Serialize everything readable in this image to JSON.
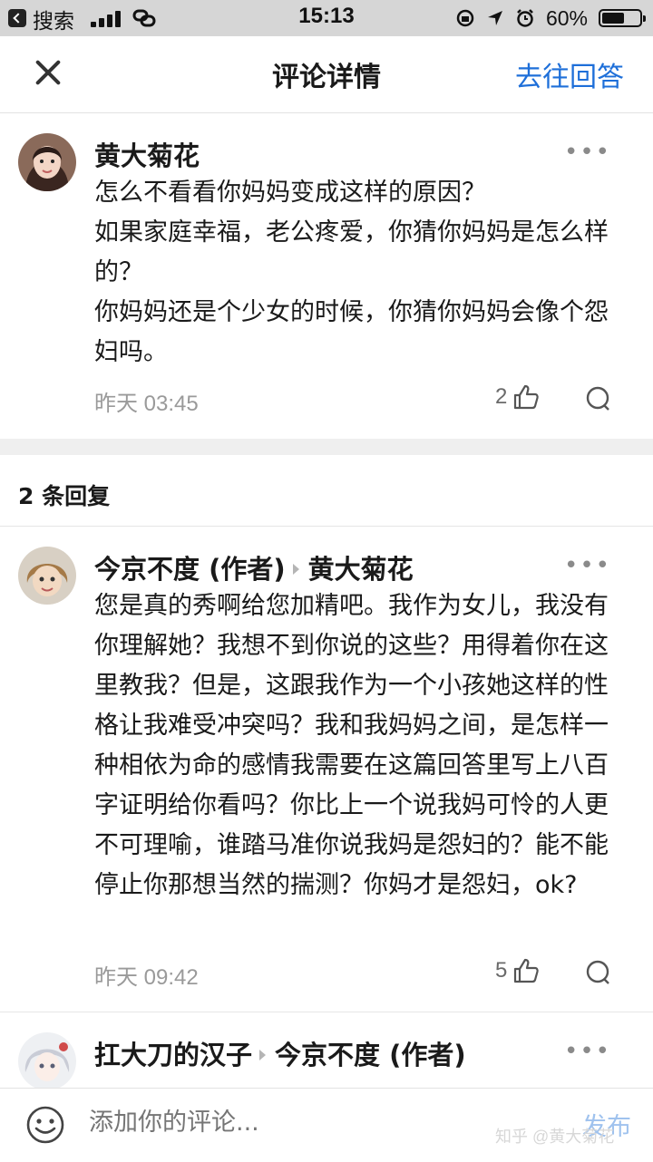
{
  "status_bar": {
    "back_label": "搜索",
    "time": "15:13",
    "battery": "60%",
    "battery_level": 0.6
  },
  "header": {
    "title": "评论详情",
    "goto_answer": "去往回答"
  },
  "main_comment": {
    "author": "黄大菊花",
    "more": "•••",
    "lines": [
      "怎么不看看你妈妈变成这样的原因？",
      "如果家庭幸福，老公疼爱，你猜你妈妈是怎么样的？",
      "你妈妈还是个少女的时候，你猜你妈妈会像个怨妇吗。"
    ],
    "time": "昨天 03:45",
    "likes": "2"
  },
  "replies_count": "2 条回复",
  "replies": [
    {
      "author": "今京不度 (作者)",
      "reply_to": "黄大菊花",
      "more": "•••",
      "text": "您是真的秀啊给您加精吧。我作为女儿，我没有你理解她？我想不到你说的这些？用得着你在这里教我？但是，这跟我作为一个小孩她这样的性格让我难受冲突吗？我和我妈妈之间，是怎样一种相依为命的感情我需要在这篇回答里写上八百字证明给你看吗？你比上一个说我妈可怜的人更不可理喻，谁踏马准你说我妈是怨妇的？能不能停止你那想当然的揣测？你妈才是怨妇，ok?",
      "time": "昨天 09:42",
      "likes": "5"
    },
    {
      "author": "扛大刀的汉子",
      "reply_to": "今京不度 (作者)",
      "more": "•••"
    }
  ],
  "bottom_bar": {
    "placeholder": "添加你的评论...",
    "publish": "发布",
    "watermark": "知乎 @黄大菊花"
  }
}
